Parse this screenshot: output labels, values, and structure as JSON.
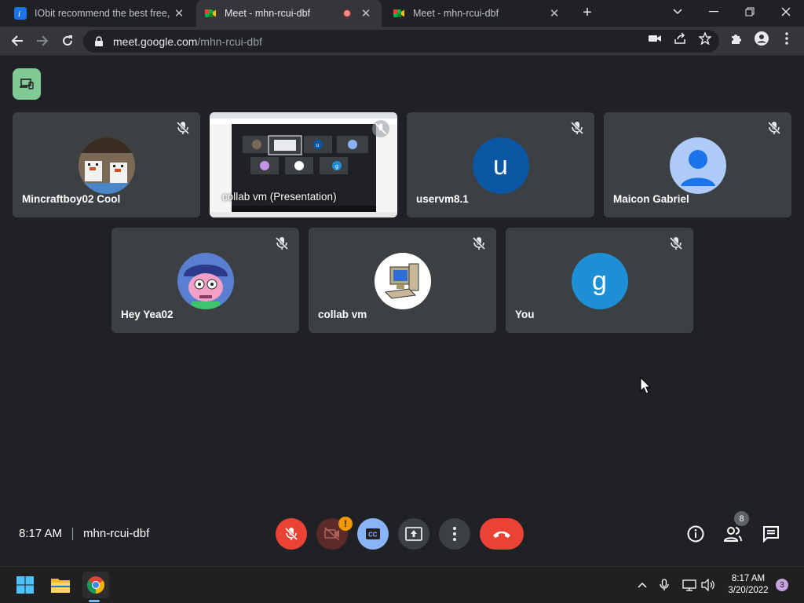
{
  "browser": {
    "tabs": [
      {
        "title": "IObit recommend the best free, f",
        "favicon": "iobit-icon",
        "active": false
      },
      {
        "title": "Meet - mhn-rcui-dbf",
        "favicon": "google-meet-icon",
        "active": true,
        "recording": true
      },
      {
        "title": "Meet - mhn-rcui-dbf",
        "favicon": "google-meet-icon",
        "active": false
      }
    ],
    "url_host": "meet.google.com",
    "url_path": "/mhn-rcui-dbf"
  },
  "meet": {
    "tiles": [
      {
        "name": "Mincraftboy02 Cool",
        "avatar": "minecraft-chickens-photo"
      },
      {
        "name": "collab vm (Presentation)",
        "avatar": "presentation-screenshot"
      },
      {
        "name": "uservm8.1",
        "avatar_letter": "u",
        "color": "#0b57a4"
      },
      {
        "name": "Maicon Gabriel",
        "avatar": "default-person-icon",
        "color": "#8ab4f8"
      },
      {
        "name": "Hey Yea02",
        "avatar": "cartoon-character-photo"
      },
      {
        "name": "collab vm",
        "avatar": "computer-clipart-photo"
      },
      {
        "name": "You",
        "avatar_letter": "g",
        "color": "#1d8fd6"
      }
    ],
    "presentation_thumb_letters": [
      "u",
      "g"
    ],
    "time": "8:17 AM",
    "meeting_code": "mhn-rcui-dbf",
    "warning_badge": "!",
    "people_count": "8"
  },
  "taskbar": {
    "clock_time": "8:17 AM",
    "clock_date": "3/20/2022",
    "notification_count": "3"
  },
  "colors": {
    "background": "#202124",
    "tile": "#3c4043",
    "end_call": "#ea4335",
    "captions": "#8ab4f8"
  }
}
